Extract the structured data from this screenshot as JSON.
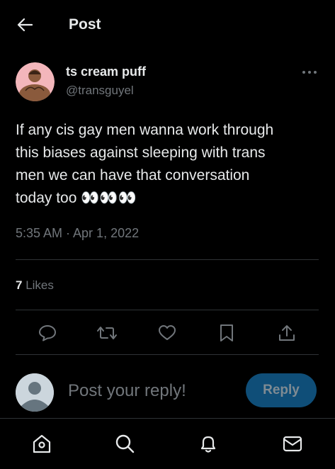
{
  "header": {
    "title": "Post"
  },
  "author": {
    "display_name": "ts cream puff",
    "handle": "@transguyel"
  },
  "tweet": {
    "lines": [
      "If any cis gay men wanna work through",
      "this biases against sleeping with trans",
      "men we can have that conversation",
      "today too "
    ],
    "emoji": "👀👀👀",
    "timestamp": "5:35 AM · Apr 1, 2022"
  },
  "stats": {
    "likes_count": "7",
    "likes_label": " Likes"
  },
  "reply": {
    "placeholder": "Post your reply!",
    "button_label": "Reply"
  },
  "icons": [
    "back-arrow-icon",
    "more-icon",
    "comment-icon",
    "repost-icon",
    "like-icon",
    "bookmark-icon",
    "share-icon",
    "home-icon",
    "search-icon",
    "notifications-icon",
    "messages-icon"
  ],
  "colors": {
    "background": "#000000",
    "text": "#e7e9ea",
    "muted": "#71767b",
    "divider": "#2f3336",
    "reply_button": "#0f4e78"
  }
}
